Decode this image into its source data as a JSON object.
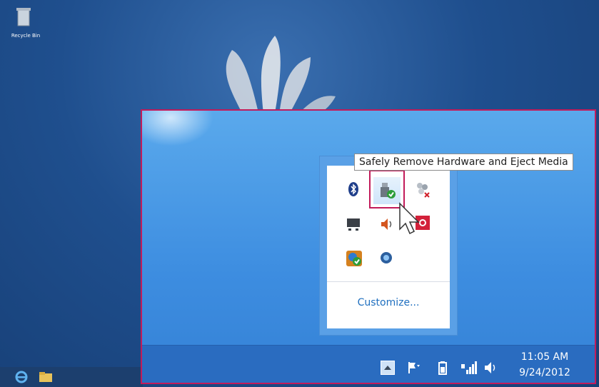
{
  "desktop": {
    "recycle_bin_label": "Recycle Bin"
  },
  "tooltip": {
    "text": "Safely Remove Hardware and Eject Media"
  },
  "flyout": {
    "customize_label": "Customize...",
    "icons": [
      "bluetooth-icon",
      "safely-remove-hardware-icon",
      "homegroup-error-icon",
      "display-icon",
      "speaker-icon",
      "action-center-icon",
      "network-status-icon",
      "sync-icon"
    ]
  },
  "tray": {
    "icons": [
      "show-hidden-icons-button",
      "action-center-flag-icon",
      "battery-icon",
      "network-signal-icon",
      "volume-icon"
    ]
  },
  "clock": {
    "time": "11:05 AM",
    "date": "9/24/2012"
  },
  "colors": {
    "highlight_border": "#c21b5a",
    "taskbar": "#2a6cc0",
    "link": "#1f6fbf"
  }
}
